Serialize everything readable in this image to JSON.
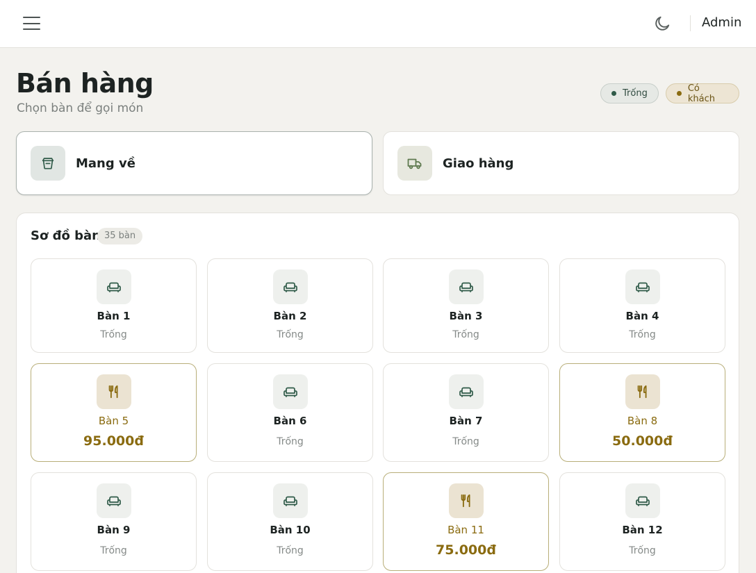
{
  "header": {
    "user_label": "Admin",
    "menu_icon": "hamburger-icon",
    "theme_icon": "moon-icon"
  },
  "page": {
    "title": "Bán hàng",
    "subtitle": "Chọn bàn để gọi món"
  },
  "legend": {
    "empty_label": "Trống",
    "busy_label": "Có khách",
    "empty_color": "#2f5a48",
    "busy_color": "#8a6b10"
  },
  "modes": [
    {
      "label": "Mang về",
      "icon": "takeaway-bag-icon"
    },
    {
      "label": "Giao hàng",
      "icon": "delivery-truck-icon"
    }
  ],
  "floor": {
    "title": "Sơ đồ bàn",
    "count_label": "35 bàn"
  },
  "tables": [
    {
      "name": "Bàn 1",
      "status": "Trống",
      "busy": false
    },
    {
      "name": "Bàn 2",
      "status": "Trống",
      "busy": false
    },
    {
      "name": "Bàn 3",
      "status": "Trống",
      "busy": false
    },
    {
      "name": "Bàn 4",
      "status": "Trống",
      "busy": false
    },
    {
      "name": "Bàn 5",
      "amount": "95.000đ",
      "busy": true
    },
    {
      "name": "Bàn 6",
      "status": "Trống",
      "busy": false
    },
    {
      "name": "Bàn 7",
      "status": "Trống",
      "busy": false
    },
    {
      "name": "Bàn 8",
      "amount": "50.000đ",
      "busy": true
    },
    {
      "name": "Bàn 9",
      "status": "Trống",
      "busy": false
    },
    {
      "name": "Bàn 10",
      "status": "Trống",
      "busy": false
    },
    {
      "name": "Bàn 11",
      "amount": "75.000đ",
      "busy": true
    },
    {
      "name": "Bàn 12",
      "status": "Trống",
      "busy": false
    }
  ]
}
